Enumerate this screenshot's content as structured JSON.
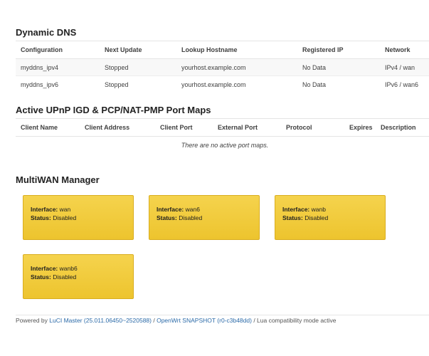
{
  "ddns": {
    "title": "Dynamic DNS",
    "columns": [
      "Configuration",
      "Next Update",
      "Lookup Hostname",
      "Registered IP",
      "Network"
    ],
    "rows": [
      [
        "myddns_ipv4",
        "Stopped",
        "yourhost.example.com",
        "No Data",
        "IPv4 / wan"
      ],
      [
        "myddns_ipv6",
        "Stopped",
        "yourhost.example.com",
        "No Data",
        "IPv6 / wan6"
      ]
    ]
  },
  "upnp": {
    "title": "Active UPnP IGD & PCP/NAT-PMP Port Maps",
    "columns": [
      "Client Name",
      "Client Address",
      "Client Port",
      "External Port",
      "Protocol",
      "Expires",
      "Description"
    ],
    "empty_text": "There are no active port maps."
  },
  "mwan": {
    "title": "MultiWAN Manager",
    "interface_label": "Interface:",
    "status_label": "Status:",
    "cards": [
      {
        "interface": "wan",
        "status": "Disabled"
      },
      {
        "interface": "wan6",
        "status": "Disabled"
      },
      {
        "interface": "wanb",
        "status": "Disabled"
      },
      {
        "interface": "wanb6",
        "status": "Disabled"
      }
    ]
  },
  "footer": {
    "powered_by": "Powered by ",
    "luci_link": "LuCI Master (25.011.06450~2520588)",
    "sep1": " / ",
    "openwrt_link": "OpenWrt SNAPSHOT (r0-c3b48dd)",
    "suffix": " / Lua compatibility mode active"
  }
}
